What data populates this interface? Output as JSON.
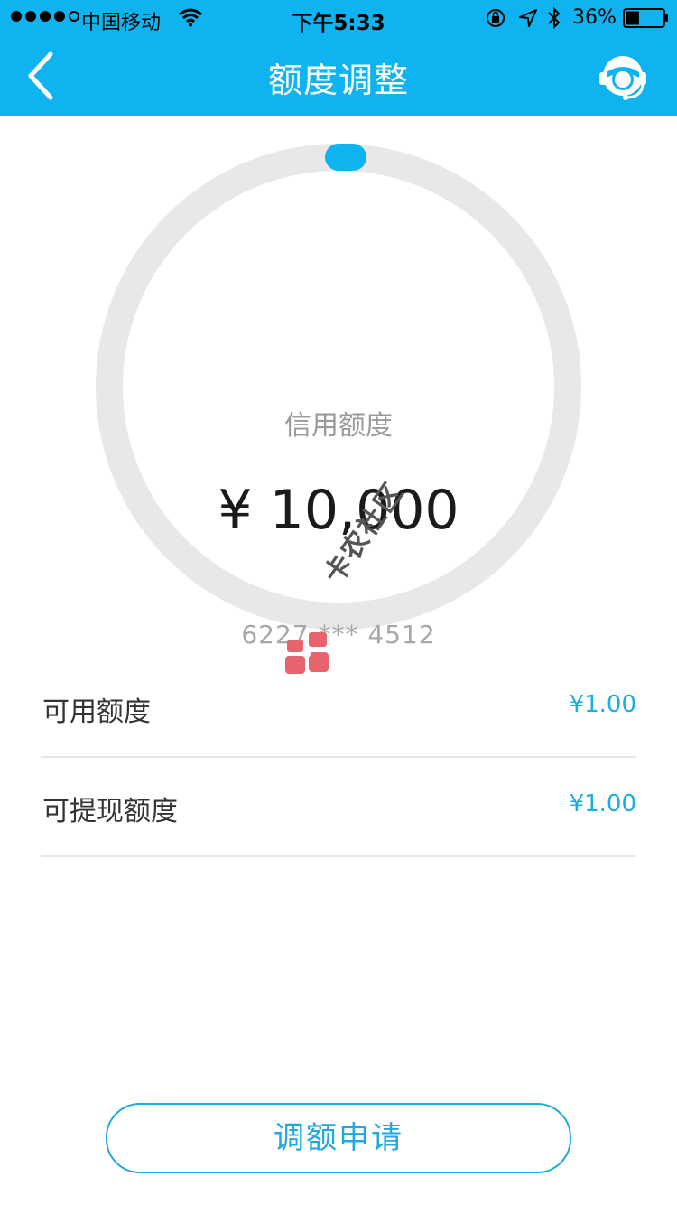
{
  "status_bar": {
    "carrier": "中国移动",
    "time": "下午5:33",
    "battery_percent": "36%",
    "signal_icon": "signal-dots-icon",
    "wifi_icon": "wifi-icon",
    "battery_level": 0.36
  },
  "nav": {
    "title": "额度调整",
    "back_icon": "chevron-left-icon",
    "service_icon": "customer-service-icon"
  },
  "credit": {
    "label": "信用额度",
    "amount": "¥ 10,000",
    "card_number": "6227 *** 4512"
  },
  "rows": [
    {
      "label": "可用额度",
      "value": "¥1.00"
    },
    {
      "label": "可提现额度",
      "value": "¥1.00"
    }
  ],
  "actions": {
    "apply_label": "调额申请"
  },
  "watermark": {
    "text": "卡农社区"
  },
  "colors": {
    "accent": "#0fb3ef",
    "value_text": "#1aaee0",
    "ring": "#e8e8e8"
  }
}
